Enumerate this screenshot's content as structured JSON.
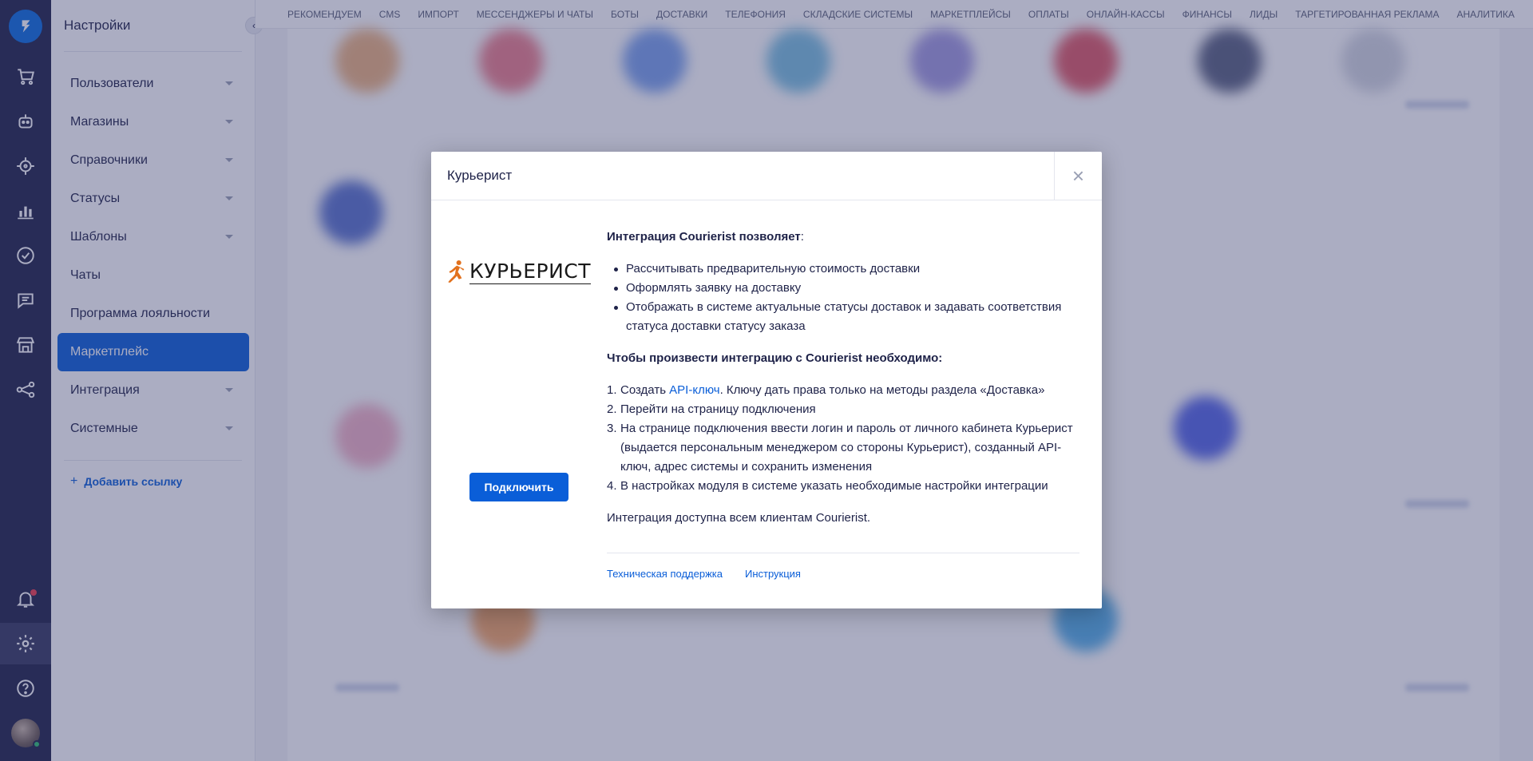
{
  "sidebar": {
    "title": "Настройки",
    "items": [
      {
        "label": "Пользователи",
        "has_caret": true
      },
      {
        "label": "Магазины",
        "has_caret": true
      },
      {
        "label": "Справочники",
        "has_caret": true
      },
      {
        "label": "Статусы",
        "has_caret": true
      },
      {
        "label": "Шаблоны",
        "has_caret": true
      },
      {
        "label": "Чаты",
        "has_caret": false
      },
      {
        "label": "Программа лояльности",
        "has_caret": false
      },
      {
        "label": "Маркетплейс",
        "has_caret": false,
        "active": true
      },
      {
        "label": "Интеграция",
        "has_caret": true
      },
      {
        "label": "Системные",
        "has_caret": true
      }
    ],
    "add_link": "Добавить ссылку"
  },
  "rail": {
    "icons": [
      "cart-icon",
      "bot-icon",
      "target-icon",
      "analytics-icon",
      "tasks-icon",
      "chats-icon",
      "store-icon",
      "integrations-icon",
      "notifications-icon",
      "settings-icon",
      "help-icon"
    ]
  },
  "topnav": {
    "categories": [
      "РЕКОМЕНДУЕМ",
      "CMS",
      "ИМПОРТ",
      "МЕССЕНДЖЕРЫ И ЧАТЫ",
      "БОТЫ",
      "ДОСТАВКИ",
      "ТЕЛЕФОНИЯ",
      "СКЛАДСКИЕ СИСТЕМЫ",
      "МАРКЕТПЛЕЙСЫ",
      "ОПЛАТЫ",
      "ОНЛАЙН-КАССЫ",
      "ФИНАНСЫ",
      "ЛИДЫ",
      "ТАРГЕТИРОВАННАЯ РЕКЛАМА",
      "АНАЛИТИКА"
    ],
    "more": "···"
  },
  "modal": {
    "title": "Курьерист",
    "close": "×",
    "logo_text": "КУРЬЕРИСТ",
    "connect_label": "Подключить",
    "intro_bold": "Интеграция Courierist позволяет",
    "intro_colon": ":",
    "features": [
      "Рассчитывать предварительную стоимость доставки",
      "Оформлять заявку на доставку",
      "Отображать в системе актуальные статусы доставок и задавать соответствия статуса доставки статусу заказа"
    ],
    "steps_heading": "Чтобы произвести интеграцию с Courierist необходимо:",
    "steps": [
      {
        "num": "1.",
        "before": "Создать ",
        "link": "API-ключ",
        "after": ". Ключу дать права только на методы раздела «Доставка»"
      },
      {
        "num": "2.",
        "before": "Перейти на страницу подключения",
        "link": "",
        "after": ""
      },
      {
        "num": "3.",
        "before": "На странице подключения ввести логин и пароль от личного кабинета Курьерист (выдается персональным менеджером со стороны Курьерист), созданный API-ключ, адрес системы и сохранить изменения",
        "link": "",
        "after": ""
      },
      {
        "num": "4.",
        "before": "В настройках модуля в системе указать необходимые настройки интеграции",
        "link": "",
        "after": ""
      }
    ],
    "availability": "Интеграция доступна всем клиентам Courierist.",
    "footer_links": [
      "Техническая поддержка",
      "Инструкция"
    ]
  },
  "colors": {
    "rail_bg": "#1e2248",
    "accent": "#0a5ed8",
    "overlay": "rgba(56,60,110,0.42)",
    "brand_orange": "#e2711d"
  }
}
